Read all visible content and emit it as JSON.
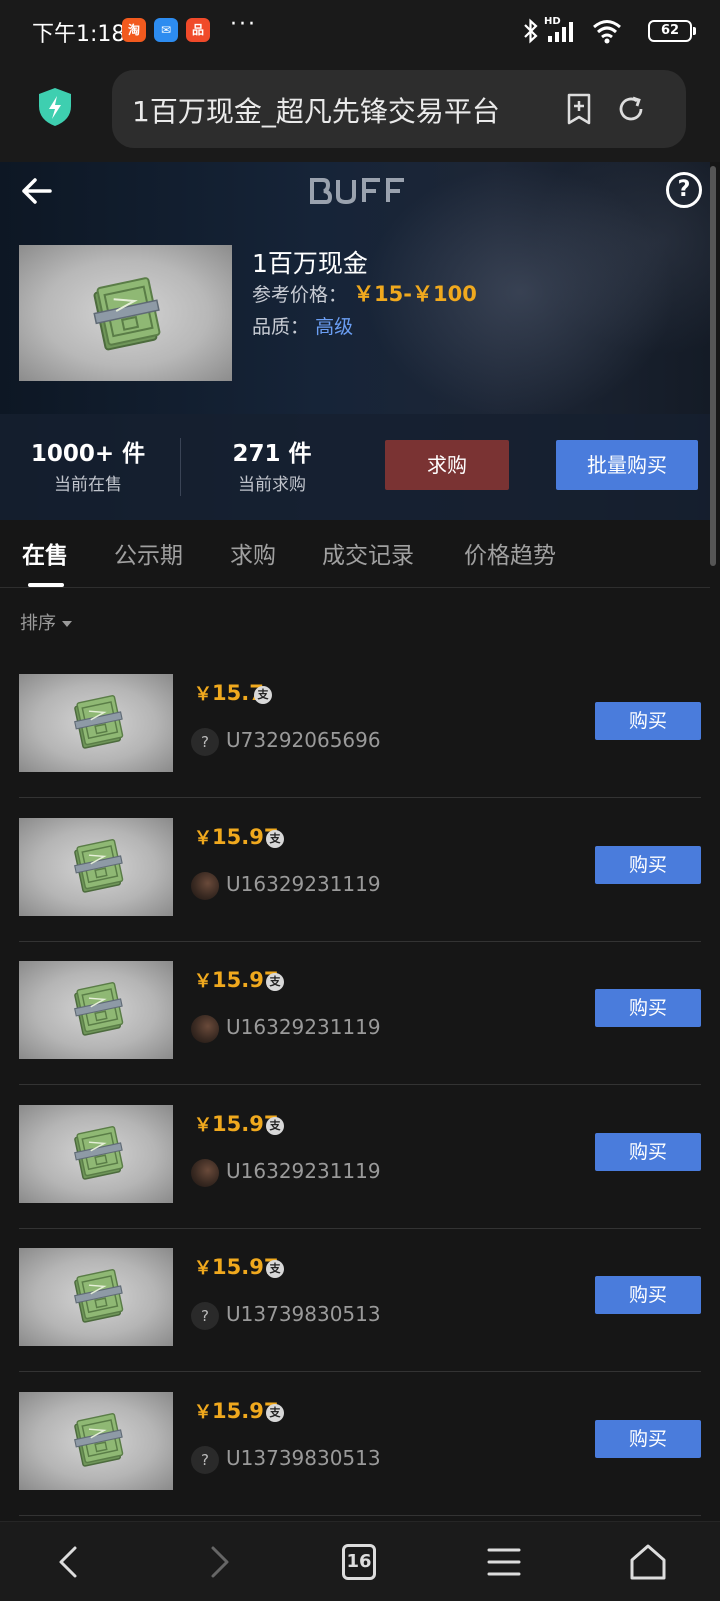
{
  "status_bar": {
    "time": "下午1:18",
    "app_icons": [
      "taobao-icon",
      "message-icon",
      "app-icon"
    ],
    "more": "···",
    "network": "HD",
    "battery": "62"
  },
  "browser": {
    "url_title": "1百万现金_超凡先锋交易平台",
    "tab_count": "16"
  },
  "hero": {
    "logo": "BUFF",
    "help": "?",
    "item_name": "1百万现金",
    "ref_price_label": "参考价格：",
    "ref_price_value": "￥15-￥100",
    "quality_label": "品质：",
    "quality_value": "高级",
    "on_sale_count": "1000+ 件",
    "on_sale_label": "当前在售",
    "want_count": "271 件",
    "want_label": "当前求购",
    "want_button": "求购",
    "bulk_buy_button": "批量购买"
  },
  "tabs": [
    {
      "label": "在售",
      "active": true
    },
    {
      "label": "公示期",
      "active": false
    },
    {
      "label": "求购",
      "active": false
    },
    {
      "label": "成交记录",
      "active": false
    },
    {
      "label": "价格趋势",
      "active": false
    }
  ],
  "sort_label": "排序",
  "listings": [
    {
      "price": "15.7",
      "user": "U73292065696",
      "avatar": "?",
      "buy": "购买"
    },
    {
      "price": "15.97",
      "user": "U16329231119",
      "avatar": "photo",
      "buy": "购买"
    },
    {
      "price": "15.97",
      "user": "U16329231119",
      "avatar": "photo",
      "buy": "购买"
    },
    {
      "price": "15.97",
      "user": "U16329231119",
      "avatar": "photo",
      "buy": "购买"
    },
    {
      "price": "15.97",
      "user": "U13739830513",
      "avatar": "?",
      "buy": "购买"
    },
    {
      "price": "15.97",
      "user": "U13739830513",
      "avatar": "?",
      "buy": "购买"
    }
  ],
  "currency_symbol": "￥",
  "pay_icon_glyph": "支",
  "colors": {
    "price": "#f0a91e",
    "buy_button": "#4a7cdc",
    "want_button": "#7a3333",
    "quality": "#6b9ef3",
    "background": "#161616"
  }
}
